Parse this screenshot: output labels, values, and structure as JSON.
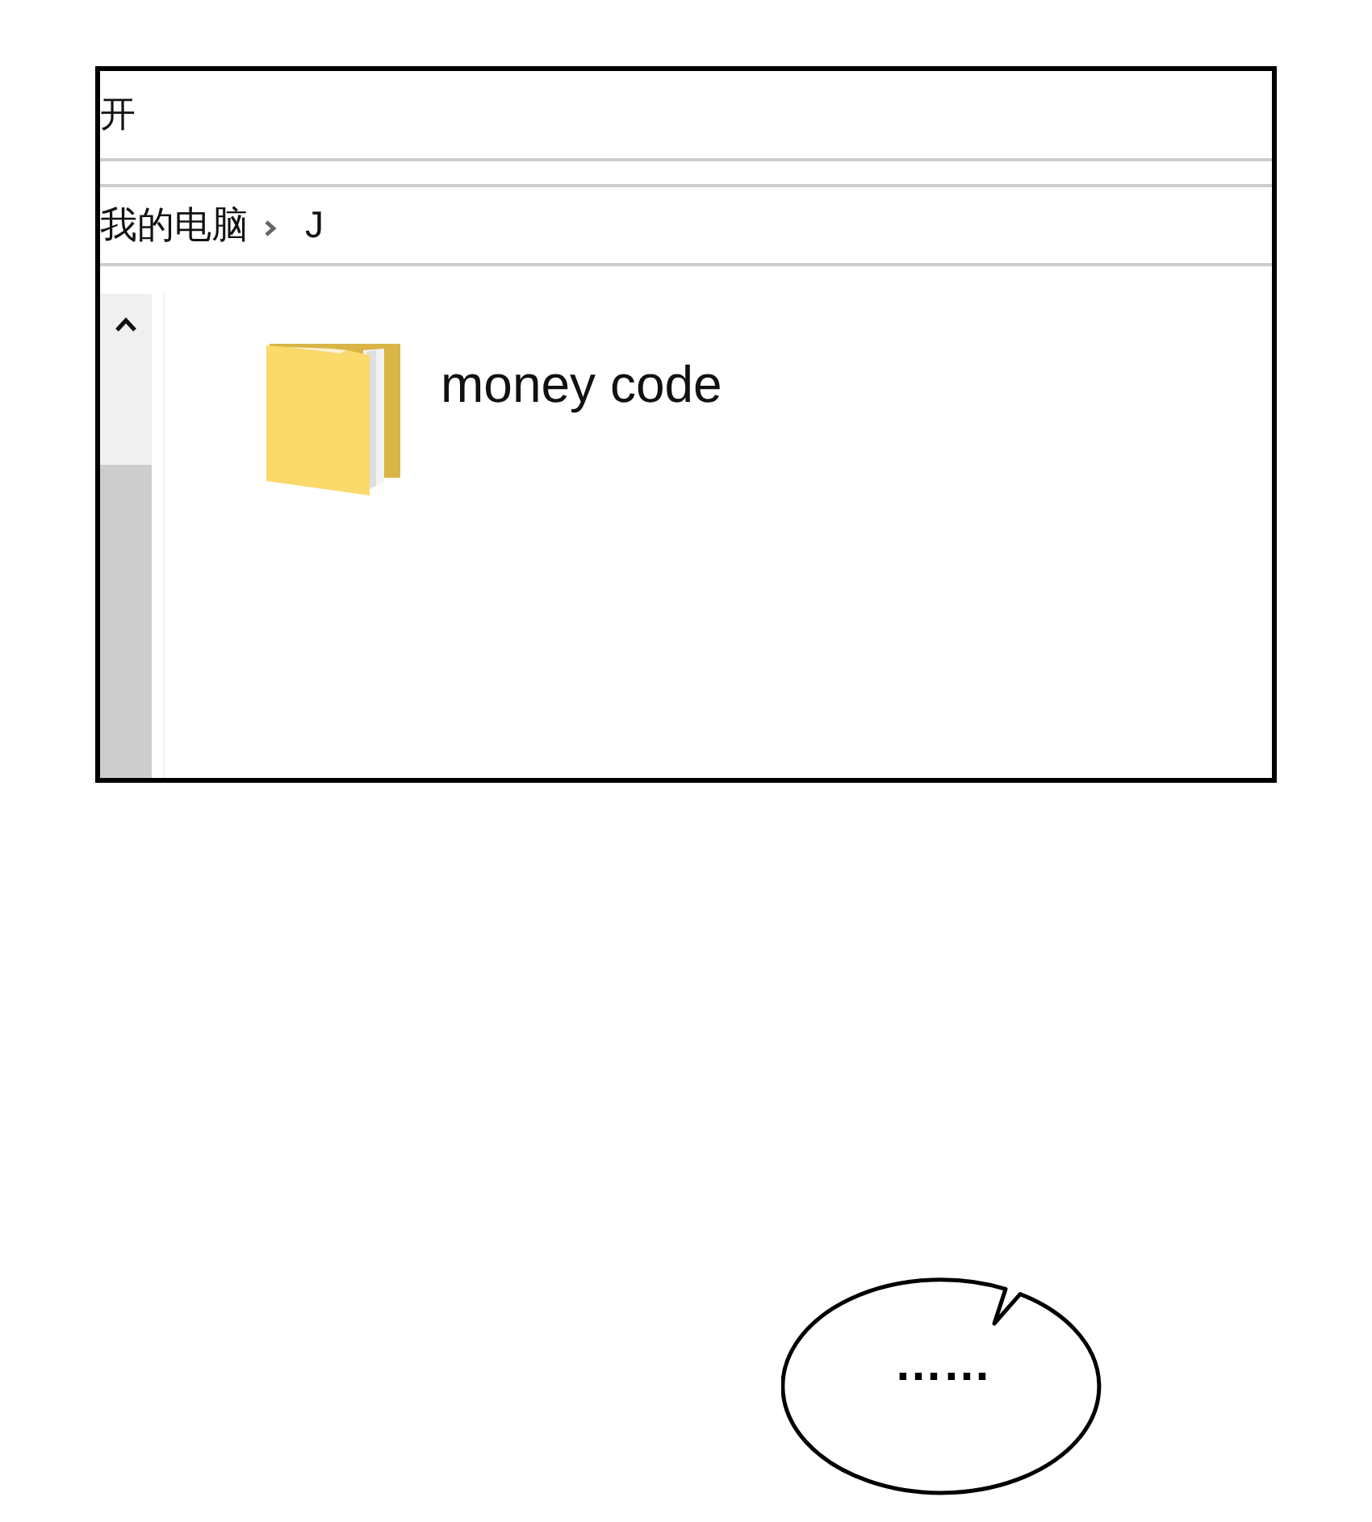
{
  "window": {
    "title": "开"
  },
  "breadcrumb": [
    {
      "label": "我的电脑"
    },
    {
      "label": "J"
    }
  ],
  "files": [
    {
      "name": "money code",
      "kind": "folder"
    }
  ],
  "speech_bubble": {
    "text": "……"
  }
}
